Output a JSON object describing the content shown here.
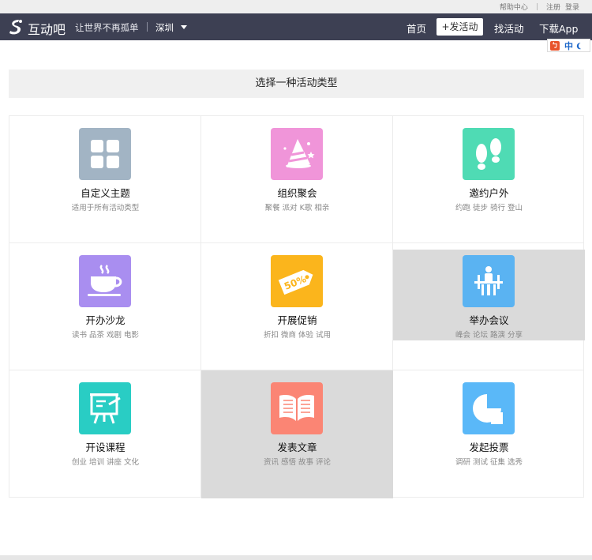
{
  "topbar": {
    "help_center": "帮助中心",
    "register": "注册",
    "login": "登录"
  },
  "navbar": {
    "brand": "互动吧",
    "slogan": "让世界不再孤单",
    "city": "深圳",
    "home": "首页",
    "post_activity": "+发活动",
    "find_activity": "找活动",
    "download_app": "下载App"
  },
  "ime": {
    "label": "中"
  },
  "page": {
    "title": "选择一种活动类型"
  },
  "categories": [
    {
      "title": "自定义主题",
      "tags": "适用于所有活动类型",
      "icon": "four-squares-icon",
      "color": "#a2b4c4"
    },
    {
      "title": "组织聚会",
      "tags": "聚餐 派对 K歌 相亲",
      "icon": "party-hat-icon",
      "color": "#f095d9"
    },
    {
      "title": "邀约户外",
      "tags": "约跑 徒步 骑行 登山",
      "icon": "footprints-icon",
      "color": "#4fdbb4"
    },
    {
      "title": "开办沙龙",
      "tags": "读书 品茶 戏剧 电影",
      "icon": "coffee-cup-icon",
      "color": "#a98ef0"
    },
    {
      "title": "开展促销",
      "tags": "折扣 微商 体验 试用",
      "icon": "discount-tag-icon",
      "color": "#fbb51c"
    },
    {
      "title": "举办会议",
      "tags": "峰会 论坛 路演 分享",
      "icon": "meeting-icon",
      "color": "#5ab3f2"
    },
    {
      "title": "开设课程",
      "tags": "创业 培训 讲座 文化",
      "icon": "easel-icon",
      "color": "#29cdc4"
    },
    {
      "title": "发表文章",
      "tags": "资讯 感悟 故事 评论",
      "icon": "open-book-icon",
      "color": "#fb8574"
    },
    {
      "title": "发起投票",
      "tags": "调研 测试 征集 选秀",
      "icon": "pie-chart-icon",
      "color": "#5ab8f8"
    }
  ]
}
